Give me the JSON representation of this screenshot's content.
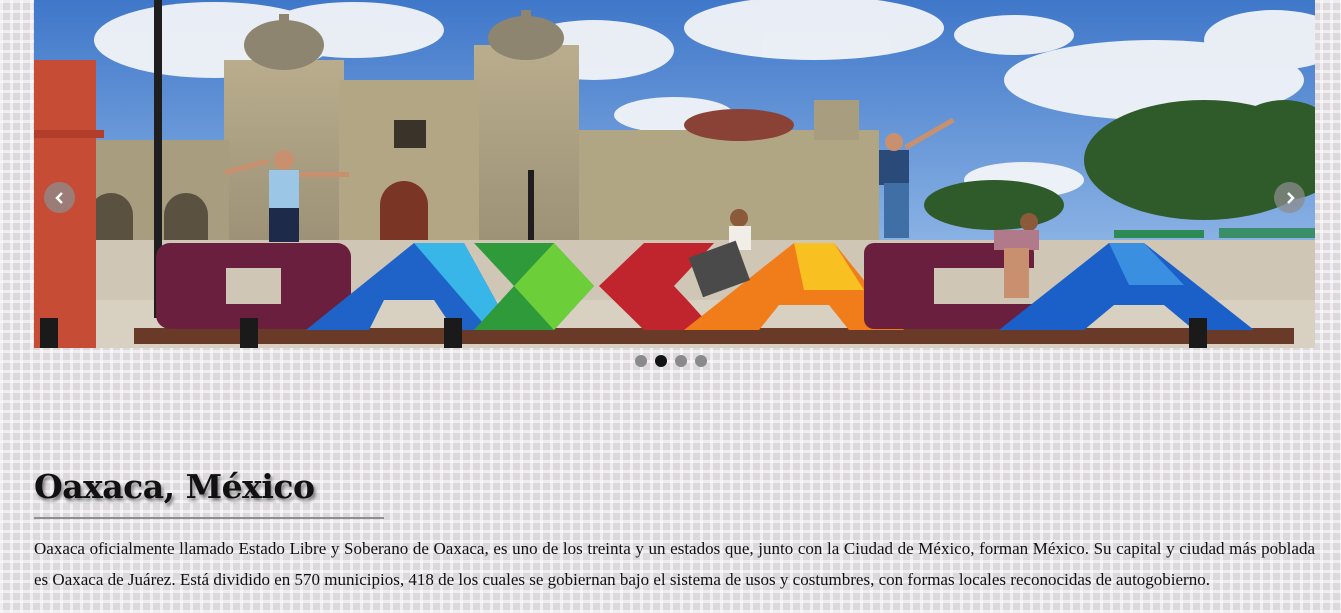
{
  "carousel": {
    "slide_count": 4,
    "active_slide": 2,
    "sign_letters": [
      "O",
      "A",
      "X",
      "A",
      "C",
      "A"
    ],
    "colors": {
      "letter_o_first": "#6a1f3e",
      "letter_a_blue": "#1f63c9",
      "letter_x_green": "#2f9a3a",
      "letter_c_red": "#c0242c",
      "letter_a_orange": "#f07d1a",
      "letter_a_last": "#1b5fc9"
    }
  },
  "article": {
    "title": "Oaxaca, México",
    "description": "Oaxaca oficialmente llamado Estado Libre y Soberano de Oaxaca, es uno de los treinta y un estados que, junto con la Ciudad de México, forman México. Su capital y ciudad más poblada es Oaxaca de Juárez. Está dividido en 570 municipios, 418 de los cuales se gobiernan bajo el sistema de usos y costumbres, con formas locales reconocidas de autogobierno."
  }
}
